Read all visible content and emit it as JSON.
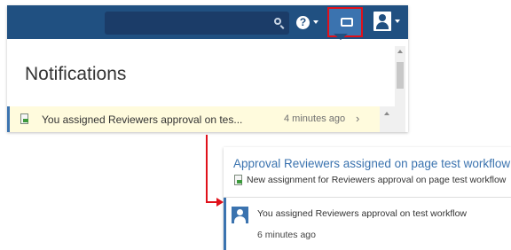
{
  "header": {
    "search_placeholder": "",
    "help_icon": "question-circle-icon",
    "notifications_icon": "inbox-icon",
    "user_icon": "user-avatar-icon"
  },
  "notifications": {
    "title": "Notifications",
    "items": [
      {
        "text": "You assigned Reviewers approval on tes...",
        "time": "4 minutes ago",
        "icon": "page-icon"
      }
    ]
  },
  "detail": {
    "title": "Approval Reviewers assigned on page test workflow",
    "subtitle": "New assignment for Reviewers approval on page test workflow",
    "entries": [
      {
        "text": "You assigned Reviewers approval on test workflow",
        "time": "6 minutes ago"
      }
    ]
  },
  "colors": {
    "header_bg": "#205081",
    "accent_blue": "#3b73af",
    "highlight_red": "#e0111b",
    "unread_row_bg": "#fffbdd"
  }
}
